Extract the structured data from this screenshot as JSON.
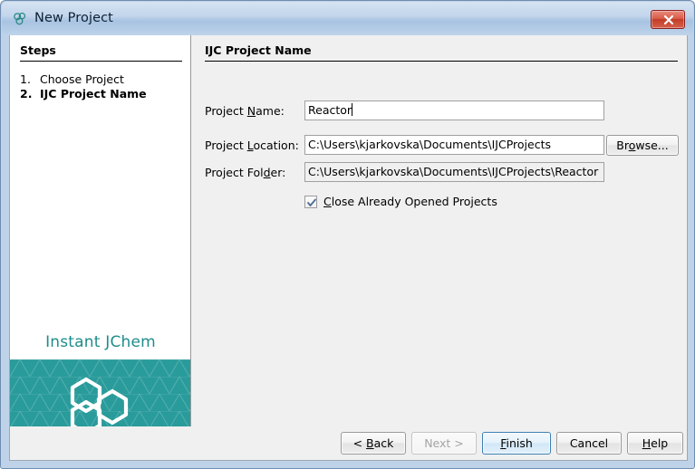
{
  "window": {
    "title": "New Project",
    "icon": "molecule-icon",
    "close_label": "x",
    "accent_teal": "#2a9b9b",
    "title_gradient_top": "#d6e3f2",
    "title_gradient_bottom": "#a8c3e2",
    "close_button_color": "#c33c28"
  },
  "steps": {
    "heading": "Steps",
    "items": [
      {
        "number": "1.",
        "label": "Choose Project",
        "active": false
      },
      {
        "number": "2.",
        "label": "IJC Project Name",
        "active": true
      }
    ]
  },
  "branding": {
    "name": "Instant JChem",
    "name_color": "#1f8c8c",
    "logo": "hexagon-cluster-logo",
    "panel_color": "#2a9b9b"
  },
  "form": {
    "heading": "IJC Project Name",
    "fields": [
      {
        "label_before": "Project ",
        "label_mnemonic": "N",
        "label_after": "ame:",
        "value": "Reactor",
        "readonly": false,
        "focused": true
      },
      {
        "label_before": "Project ",
        "label_mnemonic": "L",
        "label_after": "ocation:",
        "value": "C:\\Users\\kjarkovska\\Documents\\IJCProjects",
        "readonly": false,
        "focused": false
      },
      {
        "label_before": "Project Fol",
        "label_mnemonic": "d",
        "label_after": "er:",
        "value": "C:\\Users\\kjarkovska\\Documents\\IJCProjects\\Reactor",
        "readonly": true,
        "focused": false
      }
    ],
    "browse_button": {
      "before": "Br",
      "mnemonic": "o",
      "after": "wse..."
    },
    "checkbox": {
      "checked": true,
      "before": "",
      "mnemonic": "C",
      "after": "lose Already Opened Projects"
    }
  },
  "footer": {
    "buttons": [
      {
        "before": "< ",
        "mnemonic": "B",
        "after": "ack",
        "state": "enabled"
      },
      {
        "before": "Next >",
        "mnemonic": "",
        "after": "",
        "state": "disabled"
      },
      {
        "before": "",
        "mnemonic": "F",
        "after": "inish",
        "state": "default"
      },
      {
        "before": "Cancel",
        "mnemonic": "",
        "after": "",
        "state": "enabled"
      },
      {
        "before": "",
        "mnemonic": "H",
        "after": "elp",
        "state": "enabled"
      }
    ]
  }
}
